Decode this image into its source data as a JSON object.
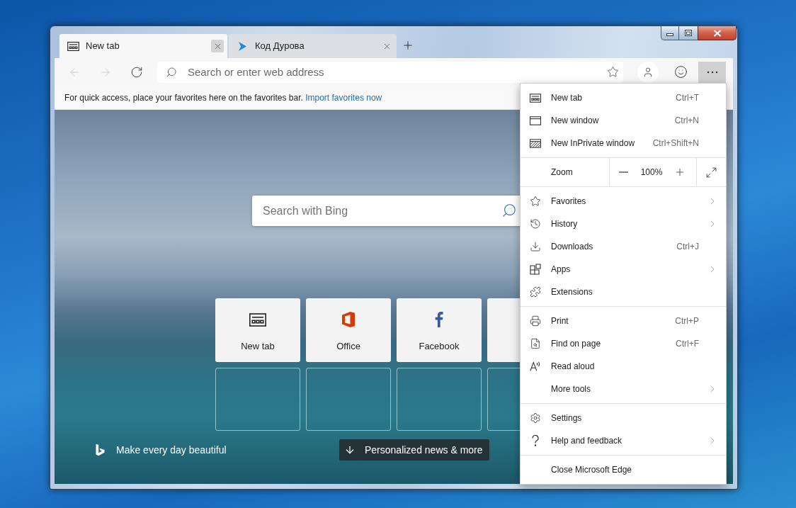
{
  "tabs": [
    {
      "label": "New tab",
      "selected": true
    },
    {
      "label": "Код Дурова",
      "selected": false
    }
  ],
  "toolbar": {
    "back": {
      "disabled": true
    },
    "forward": {
      "disabled": true
    },
    "address_bar": {
      "placeholder": "Search or enter web address"
    },
    "more_button": {
      "pressed": true
    }
  },
  "favorites_bar": {
    "message": "For quick access, place your favorites here on the favorites bar.",
    "link": "Import favorites now"
  },
  "new_tab_page": {
    "search": {
      "placeholder": "Search with Bing"
    },
    "top_sites": [
      {
        "kind": "newtab",
        "label": "New tab"
      },
      {
        "kind": "office",
        "label": "Office"
      },
      {
        "kind": "facebook",
        "label": "Facebook"
      },
      {
        "kind": "covered"
      },
      {
        "kind": "empty"
      },
      {
        "kind": "empty"
      },
      {
        "kind": "empty"
      },
      {
        "kind": "empty"
      }
    ],
    "tagline": "Make every day beautiful",
    "news_button": "Personalized news & more"
  },
  "menu": {
    "sections": [
      {
        "kind": "items",
        "items": [
          {
            "label": "New tab",
            "shortcut": "Ctrl+T",
            "submenu": false
          },
          {
            "label": "New window",
            "shortcut": "Ctrl+N",
            "submenu": false
          },
          {
            "label": "New InPrivate window",
            "shortcut": "Ctrl+Shift+N",
            "submenu": false
          }
        ]
      },
      {
        "kind": "zoom",
        "label": "Zoom",
        "value": "100%"
      },
      {
        "kind": "items",
        "items": [
          {
            "label": "Favorites",
            "submenu": true
          },
          {
            "label": "History",
            "submenu": true
          },
          {
            "label": "Downloads",
            "shortcut": "Ctrl+J",
            "submenu": false
          },
          {
            "label": "Apps",
            "submenu": true
          },
          {
            "label": "Extensions",
            "submenu": false
          }
        ]
      },
      {
        "kind": "items",
        "items": [
          {
            "label": "Print",
            "shortcut": "Ctrl+P",
            "submenu": false
          },
          {
            "label": "Find on page",
            "shortcut": "Ctrl+F",
            "submenu": false
          },
          {
            "label": "Read aloud",
            "submenu": false
          },
          {
            "label": "More tools",
            "submenu": true
          }
        ]
      },
      {
        "kind": "items",
        "items": [
          {
            "label": "Settings",
            "submenu": false
          },
          {
            "label": "Help and feedback",
            "submenu": true
          }
        ]
      },
      {
        "kind": "items",
        "items": [
          {
            "label": "Close Microsoft Edge",
            "submenu": false
          }
        ]
      }
    ]
  }
}
